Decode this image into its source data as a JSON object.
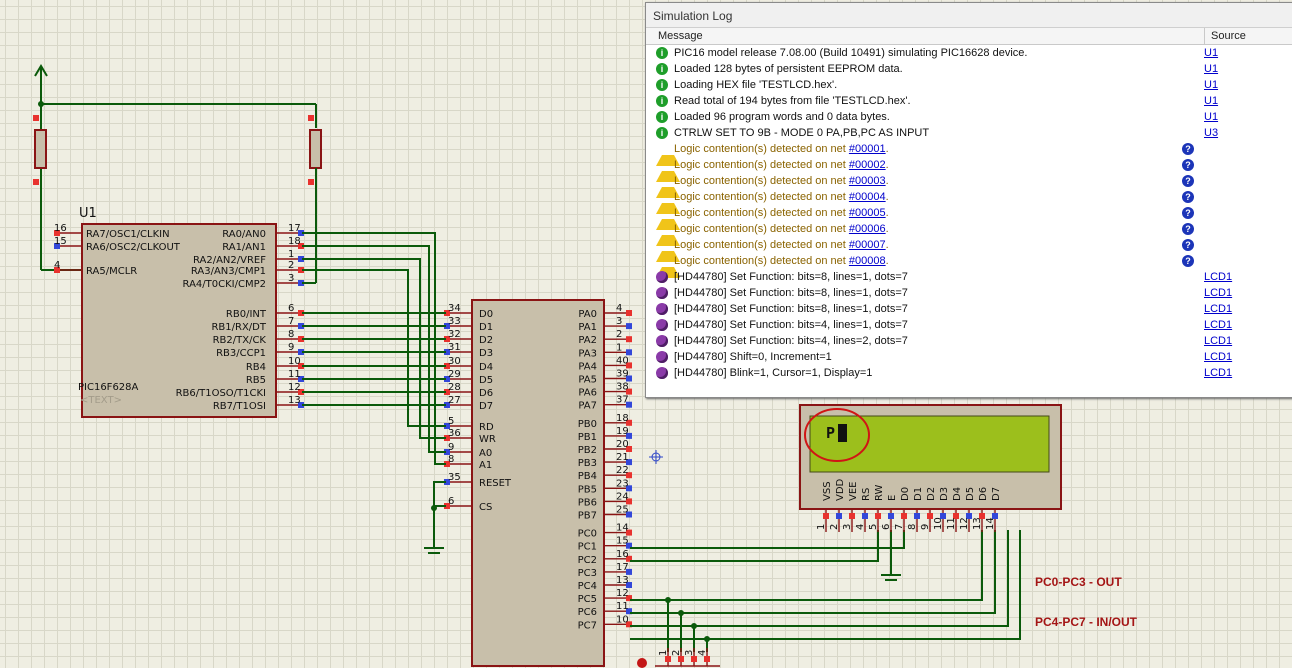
{
  "schematic": {
    "u1": {
      "ref": "U1",
      "part": "PIC16F628A",
      "text_placeholder": "<TEXT>",
      "left_pins": [
        {
          "num": "16",
          "name": "RA7/OSC1/CLKIN"
        },
        {
          "num": "15",
          "name": "RA6/OSC2/CLKOUT"
        },
        {
          "num": "4",
          "name": "RA5/MCLR"
        }
      ],
      "right_pins": [
        {
          "num": "17",
          "name": "RA0/AN0"
        },
        {
          "num": "18",
          "name": "RA1/AN1"
        },
        {
          "num": "1",
          "name": "RA2/AN2/VREF"
        },
        {
          "num": "2",
          "name": "RA3/AN3/CMP1"
        },
        {
          "num": "3",
          "name": "RA4/T0CKI/CMP2"
        },
        {
          "num": "6",
          "name": "RB0/INT"
        },
        {
          "num": "7",
          "name": "RB1/RX/DT"
        },
        {
          "num": "8",
          "name": "RB2/TX/CK"
        },
        {
          "num": "9",
          "name": "RB3/CCP1"
        },
        {
          "num": "10",
          "name": "RB4"
        },
        {
          "num": "11",
          "name": "RB5"
        },
        {
          "num": "12",
          "name": "RB6/T1OSO/T1CKI"
        },
        {
          "num": "13",
          "name": "RB7/T1OSI"
        }
      ]
    },
    "ppi": {
      "left_pins": [
        {
          "num": "34",
          "name": "D0"
        },
        {
          "num": "33",
          "name": "D1"
        },
        {
          "num": "32",
          "name": "D2"
        },
        {
          "num": "31",
          "name": "D3"
        },
        {
          "num": "30",
          "name": "D4"
        },
        {
          "num": "29",
          "name": "D5"
        },
        {
          "num": "28",
          "name": "D6"
        },
        {
          "num": "27",
          "name": "D7"
        },
        {
          "num": "5",
          "name": "RD"
        },
        {
          "num": "36",
          "name": "WR"
        },
        {
          "num": "9",
          "name": "A0"
        },
        {
          "num": "8",
          "name": "A1"
        },
        {
          "num": "35",
          "name": "RESET"
        },
        {
          "num": "6",
          "name": "CS"
        }
      ],
      "right_pins": [
        {
          "num": "4",
          "name": "PA0"
        },
        {
          "num": "3",
          "name": "PA1"
        },
        {
          "num": "2",
          "name": "PA2"
        },
        {
          "num": "1",
          "name": "PA3"
        },
        {
          "num": "40",
          "name": "PA4"
        },
        {
          "num": "39",
          "name": "PA5"
        },
        {
          "num": "38",
          "name": "PA6"
        },
        {
          "num": "37",
          "name": "PA7"
        },
        {
          "num": "18",
          "name": "PB0"
        },
        {
          "num": "19",
          "name": "PB1"
        },
        {
          "num": "20",
          "name": "PB2"
        },
        {
          "num": "21",
          "name": "PB3"
        },
        {
          "num": "22",
          "name": "PB4"
        },
        {
          "num": "23",
          "name": "PB5"
        },
        {
          "num": "24",
          "name": "PB6"
        },
        {
          "num": "25",
          "name": "PB7"
        },
        {
          "num": "14",
          "name": "PC0"
        },
        {
          "num": "15",
          "name": "PC1"
        },
        {
          "num": "16",
          "name": "PC2"
        },
        {
          "num": "17",
          "name": "PC3"
        },
        {
          "num": "13",
          "name": "PC4"
        },
        {
          "num": "12",
          "name": "PC5"
        },
        {
          "num": "11",
          "name": "PC6"
        },
        {
          "num": "10",
          "name": "PC7"
        }
      ]
    },
    "lcd": {
      "screen_text": "P",
      "pins": [
        {
          "num": "1",
          "name": "VSS"
        },
        {
          "num": "2",
          "name": "VDD"
        },
        {
          "num": "3",
          "name": "VEE"
        },
        {
          "num": "4",
          "name": "RS"
        },
        {
          "num": "5",
          "name": "RW"
        },
        {
          "num": "6",
          "name": "E"
        },
        {
          "num": "7",
          "name": "D0"
        },
        {
          "num": "8",
          "name": "D1"
        },
        {
          "num": "9",
          "name": "D2"
        },
        {
          "num": "10",
          "name": "D3"
        },
        {
          "num": "11",
          "name": "D4"
        },
        {
          "num": "12",
          "name": "D5"
        },
        {
          "num": "13",
          "name": "D6"
        },
        {
          "num": "14",
          "name": "D7"
        }
      ]
    },
    "bottom_pins": [
      "1",
      "2",
      "3",
      "4"
    ],
    "notes": {
      "pc_low": "PC0-PC3 - OUT",
      "pc_high": "PC4-PC7 - IN/OUT"
    }
  },
  "simlog": {
    "title": "Simulation Log",
    "col_message": "Message",
    "col_source": "Source",
    "rows": [
      {
        "type": "info",
        "text": "PIC16 model release 7.08.00 (Build 10491) simulating PIC16628 device.",
        "source": "U1"
      },
      {
        "type": "info",
        "text": "Loaded 128 bytes of persistent EEPROM data.",
        "source": "U1"
      },
      {
        "type": "info",
        "text": "Loading HEX file 'TESTLCD.hex'.",
        "source": "U1"
      },
      {
        "type": "info",
        "text": "Read total of 194 bytes from file 'TESTLCD.hex'.",
        "source": "U1"
      },
      {
        "type": "info",
        "text": "Loaded 96 program words and 0 data bytes.",
        "source": "U1"
      },
      {
        "type": "info",
        "text": "CTRLW SET TO 9B - MODE 0 PA,PB,PC AS INPUT",
        "source": "U3"
      },
      {
        "type": "warn",
        "text": "Logic contention(s) detected on net ",
        "net": "#00001",
        "source": ""
      },
      {
        "type": "warn",
        "text": "Logic contention(s) detected on net ",
        "net": "#00002",
        "source": ""
      },
      {
        "type": "warn",
        "text": "Logic contention(s) detected on net ",
        "net": "#00003",
        "source": ""
      },
      {
        "type": "warn",
        "text": "Logic contention(s) detected on net ",
        "net": "#00004",
        "source": ""
      },
      {
        "type": "warn",
        "text": "Logic contention(s) detected on net ",
        "net": "#00005",
        "source": ""
      },
      {
        "type": "warn",
        "text": "Logic contention(s) detected on net ",
        "net": "#00006",
        "source": ""
      },
      {
        "type": "warn",
        "text": "Logic contention(s) detected on net ",
        "net": "#00007",
        "source": ""
      },
      {
        "type": "warn",
        "text": "Logic contention(s) detected on net ",
        "net": "#00008",
        "source": ""
      },
      {
        "type": "chip",
        "text": "[HD44780] Set Function: bits=8, lines=1, dots=7",
        "source": "LCD1"
      },
      {
        "type": "chip",
        "text": "[HD44780] Set Function: bits=8, lines=1, dots=7",
        "source": "LCD1"
      },
      {
        "type": "chip",
        "text": "[HD44780] Set Function: bits=8, lines=1, dots=7",
        "source": "LCD1"
      },
      {
        "type": "chip",
        "text": "[HD44780] Set Function: bits=4, lines=1, dots=7",
        "source": "LCD1"
      },
      {
        "type": "chip",
        "text": "[HD44780] Set Function: bits=4, lines=2, dots=7",
        "source": "LCD1"
      },
      {
        "type": "chip",
        "text": "[HD44780] Shift=0, Increment=1",
        "source": "LCD1"
      },
      {
        "type": "chip",
        "text": "[HD44780] Blink=1, Cursor=1, Display=1",
        "source": "LCD1"
      }
    ]
  }
}
